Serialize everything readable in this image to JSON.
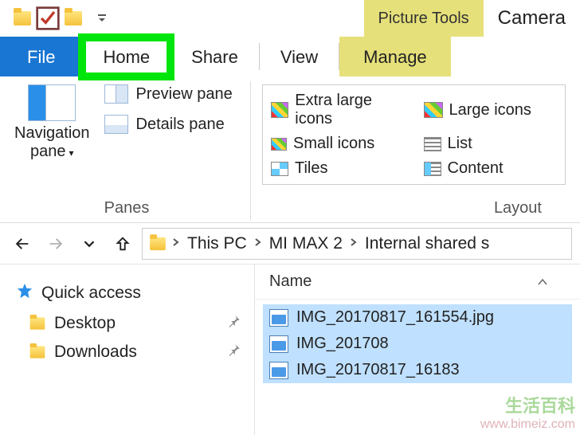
{
  "titlebar": {
    "picture_tools": "Picture Tools",
    "title": "Camera"
  },
  "tabs": {
    "file": "File",
    "home": "Home",
    "share": "Share",
    "view": "View",
    "manage": "Manage"
  },
  "ribbon": {
    "panes": {
      "navigation_pane": "Navigation",
      "navigation_pane_line2": "pane",
      "preview_pane": "Preview pane",
      "details_pane": "Details pane",
      "group_label": "Panes"
    },
    "layout": {
      "extra_large": "Extra large icons",
      "large": "Large icons",
      "small": "Small icons",
      "list": "List",
      "tiles": "Tiles",
      "content": "Content",
      "group_label": "Layout"
    }
  },
  "breadcrumb": {
    "items": [
      "This PC",
      "MI MAX 2",
      "Internal shared s"
    ]
  },
  "sidebar": {
    "quick_access": "Quick access",
    "desktop": "Desktop",
    "downloads": "Downloads"
  },
  "content": {
    "column_name": "Name",
    "files": [
      "IMG_20170817_161554.jpg",
      "IMG_201708",
      "IMG_20170817_16183"
    ]
  },
  "watermark": {
    "line1": "生活百科",
    "line2": "www.bimeiz.com"
  }
}
